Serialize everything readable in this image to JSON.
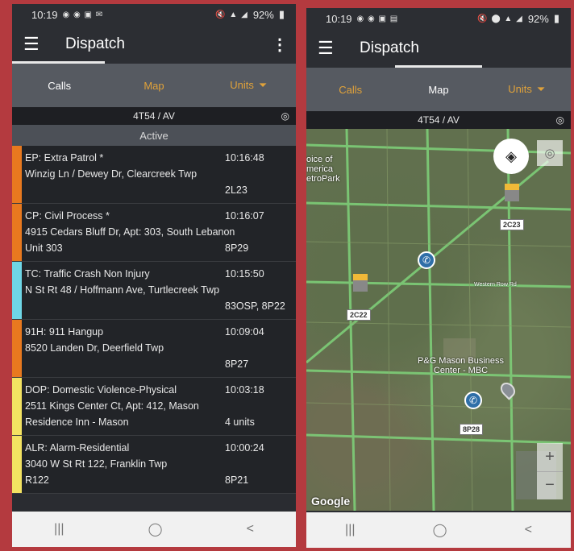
{
  "colors": {
    "background": "#b43a3f",
    "tab_inactive": "#e0a23a",
    "stripe_orange": "#e8791f",
    "stripe_cyan": "#6fd6e6",
    "stripe_yellow": "#f3e262"
  },
  "left": {
    "status": {
      "time": "10:19",
      "battery": "92%"
    },
    "app_title": "Dispatch",
    "tabs": {
      "calls": "Calls",
      "map": "Map",
      "units": "Units"
    },
    "unit_bar": "4T54 / AV",
    "section": "Active",
    "calls": [
      {
        "title": "EP: Extra Patrol *",
        "time": "10:16:48",
        "address": "Winzig Ln / Dewey Dr, Clearcreek Twp",
        "extra": "",
        "units": "2L23",
        "stripe": "#e8791f"
      },
      {
        "title": "CP: Civil Process *",
        "time": "10:16:07",
        "address": "4915 Cedars Bluff Dr, Apt: 303, South Lebanon",
        "extra": "Unit 303",
        "units": "8P29",
        "stripe": "#e8791f"
      },
      {
        "title": "TC: Traffic Crash Non Injury",
        "time": "10:15:50",
        "address": "N St Rt 48 / Hoffmann Ave, Turtlecreek Twp",
        "extra": "",
        "units": "83OSP, 8P22",
        "stripe": "#6fd6e6"
      },
      {
        "title": "91H: 911 Hangup",
        "time": "10:09:04",
        "address": "8520 Landen Dr, Deerfield Twp",
        "extra": "",
        "units": "8P27",
        "stripe": "#e8791f"
      },
      {
        "title": "DOP: Domestic Violence-Physical",
        "time": "10:03:18",
        "address": "2511 Kings Center Ct, Apt: 412, Mason",
        "extra": "Residence Inn - Mason",
        "units": "4 units",
        "stripe": "#f3e262"
      },
      {
        "title": "ALR: Alarm-Residential",
        "time": "10:00:24",
        "address": "3040 W St Rt 122, Franklin Twp",
        "extra": "R122",
        "units": "8P21",
        "stripe": "#f3e262"
      }
    ],
    "icons": {
      "menu": "menu-icon",
      "more": "more-vert-icon",
      "filter": "filter-icon",
      "locate": "gps-icon"
    }
  },
  "right": {
    "status": {
      "time": "10:19",
      "battery": "92%"
    },
    "app_title": "Dispatch",
    "tabs": {
      "calls": "Calls",
      "map": "Map",
      "units": "Units"
    },
    "unit_bar": "4T54 / AV",
    "map": {
      "labels": {
        "voice": "oice of\nmerica\netroPark",
        "mason_center": "P&G Mason Business\nCenter - MBC",
        "western_row": "Western Row Rd"
      },
      "units": [
        "2C23",
        "2C22",
        "8P28"
      ],
      "zoom_in": "+",
      "zoom_out": "−",
      "attribution": "Google"
    }
  },
  "navbar": {
    "recent": "|||",
    "home": "◯",
    "back": "<"
  }
}
